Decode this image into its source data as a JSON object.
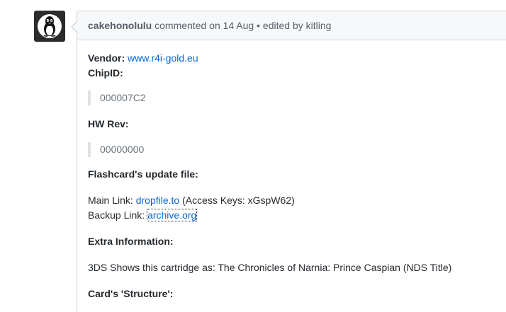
{
  "comment": {
    "author": "cakehonolulu",
    "commented_text": "commented on 14 Aug",
    "separator": "•",
    "edited_text": "edited by kitling"
  },
  "body": {
    "vendor_label": "Vendor:",
    "vendor_link": "www.r4i-gold.eu",
    "chipid_label": "ChipID:",
    "chipid_value": "000007C2",
    "hwrev_label": "HW Rev:",
    "hwrev_value": "00000000",
    "update_file_title": "Flashcard's update file:",
    "main_link_label": "Main Link:",
    "main_link_text": "dropfile.to",
    "main_link_suffix": "(Access Keys: xGspW62)",
    "backup_link_label": "Backup Link:",
    "backup_link_text": "archive.org",
    "extra_info_title": "Extra Information:",
    "extra_info_text": "3DS Shows this cartridge as: The Chronicles of Narnia: Prince Caspian (NDS Title)",
    "structure_title": "Card's 'Structure':"
  },
  "icons": {
    "avatar": "linux-penguin-avatar"
  },
  "colors": {
    "link": "#0366d6",
    "header_bg": "#f6f8fa",
    "border": "#d1d5da",
    "text": "#24292e",
    "muted": "#586069"
  }
}
